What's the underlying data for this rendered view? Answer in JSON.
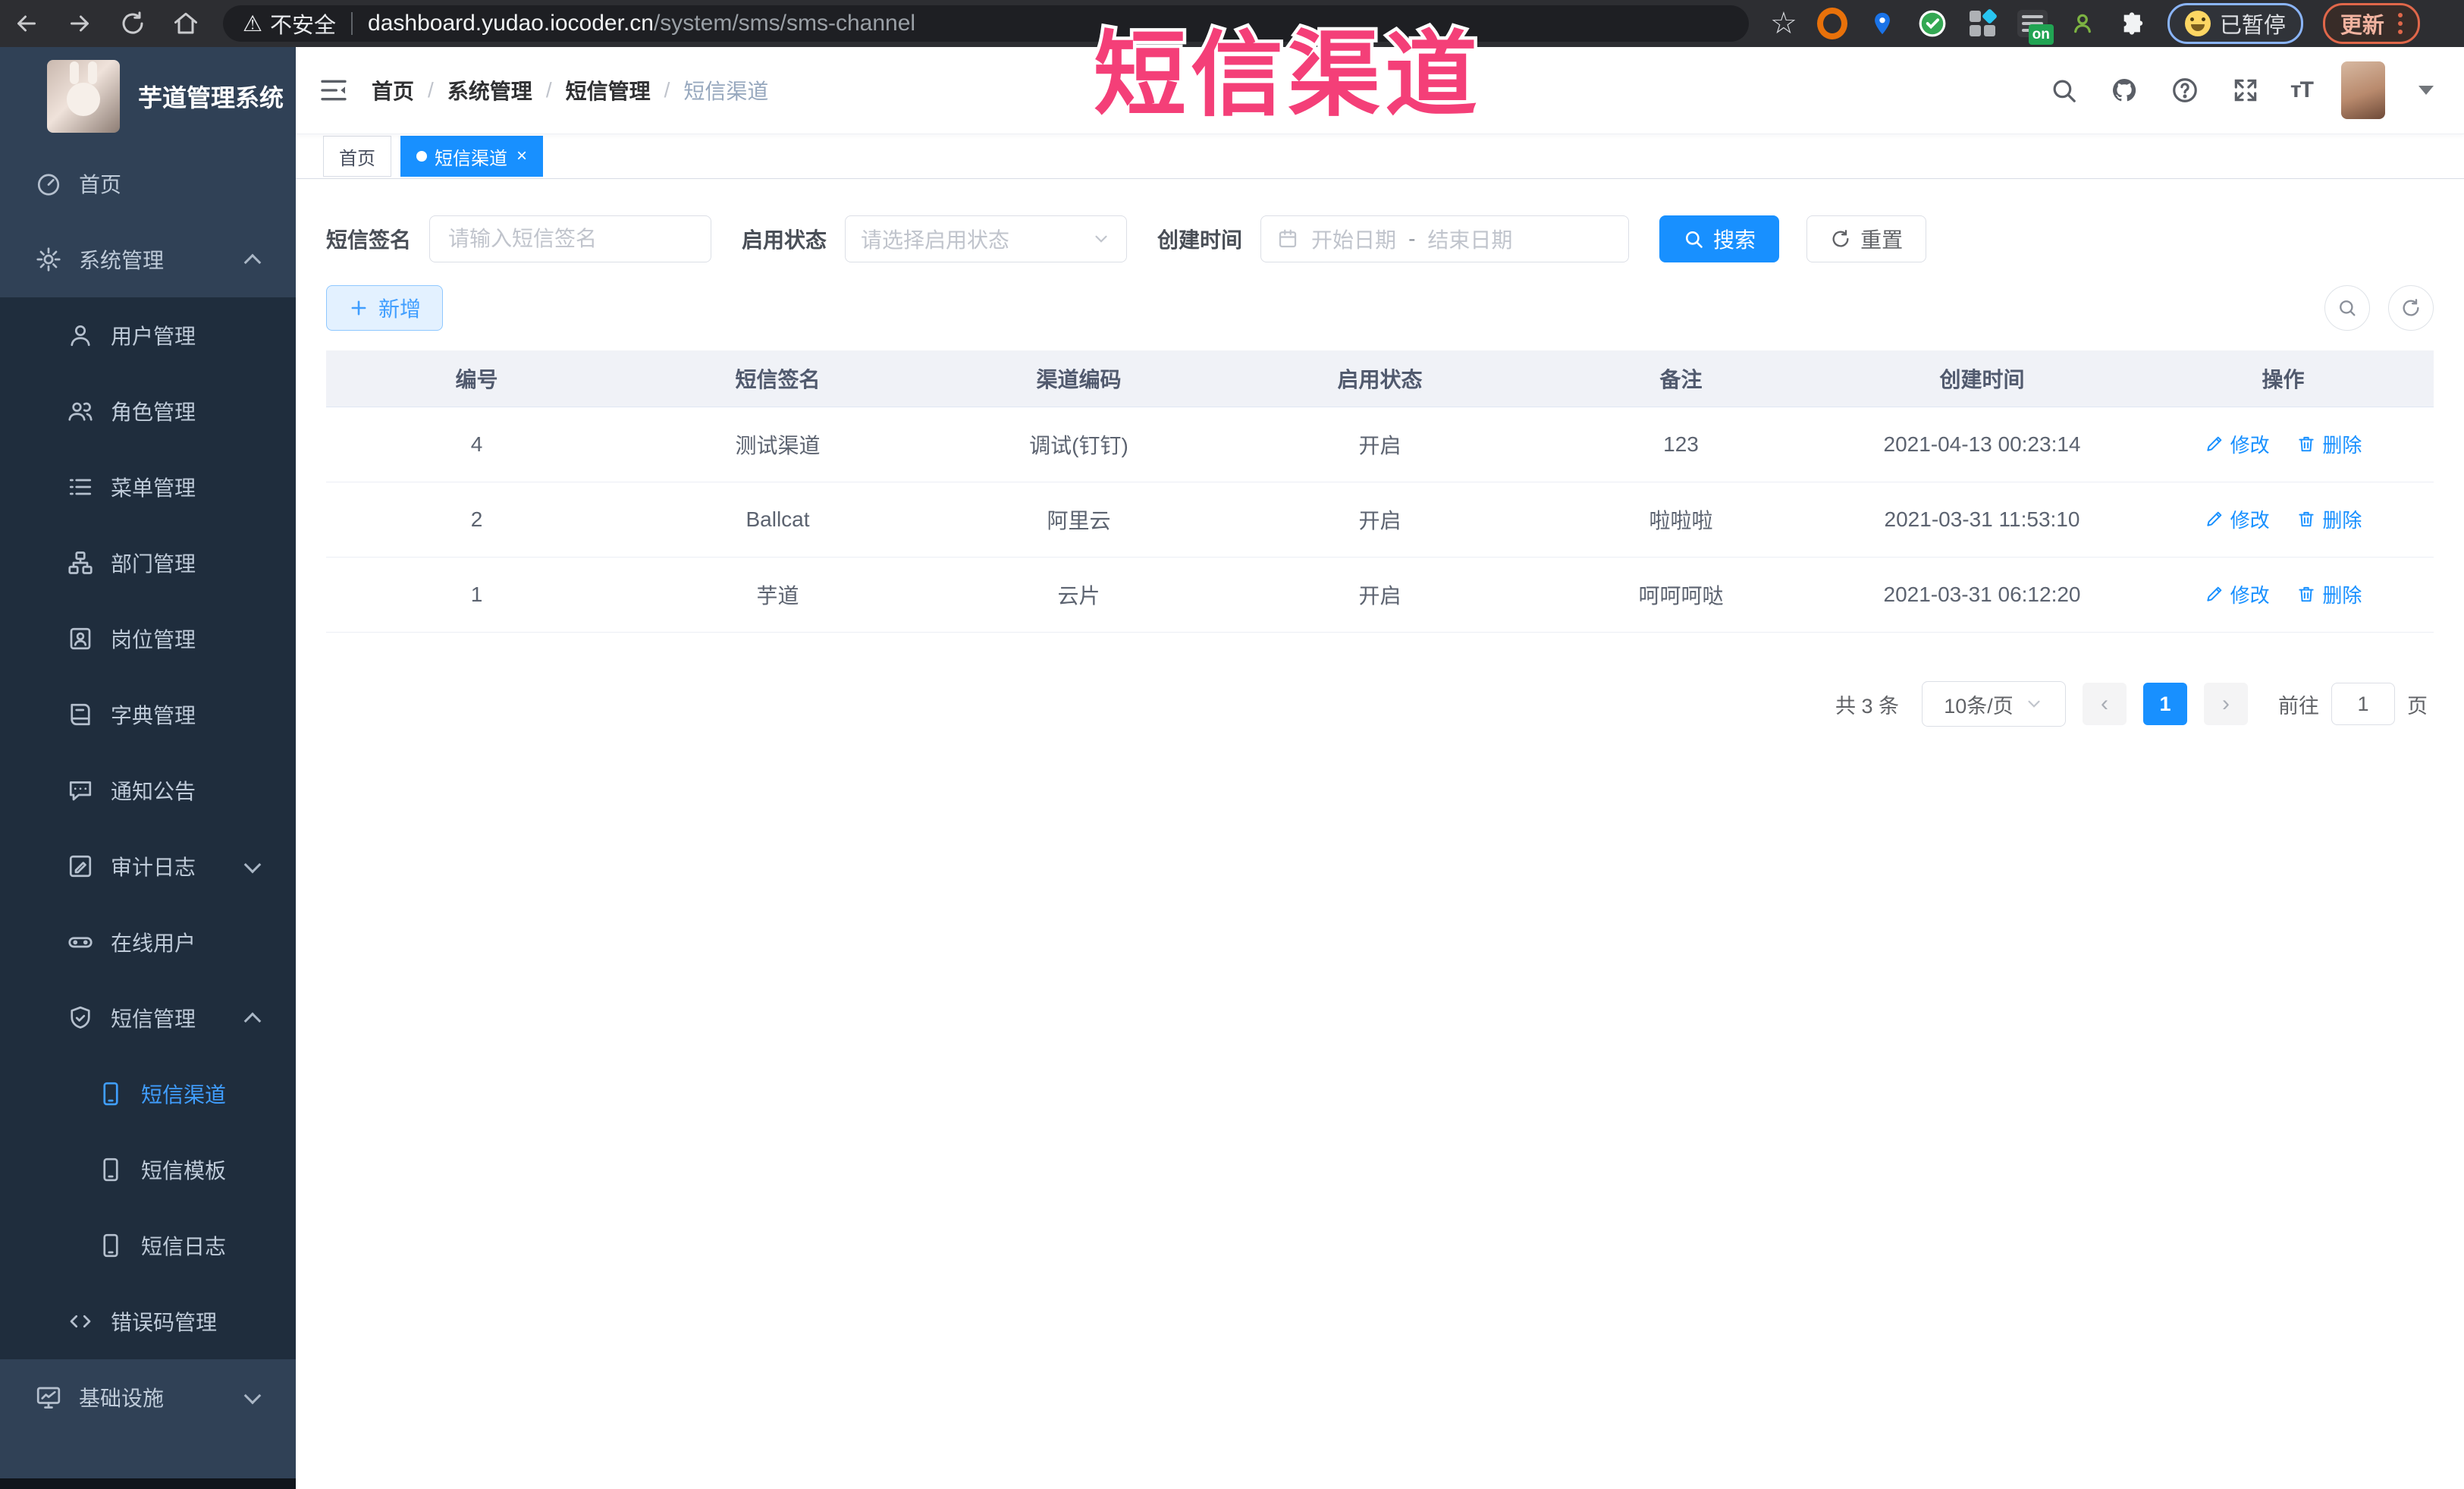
{
  "browser": {
    "security_label": "不安全",
    "url_host": "dashboard.yudao.iocoder.cn",
    "url_path": "/system/sms/sms-channel",
    "extension_badge": "on",
    "paused_label": "已暂停",
    "update_label": "更新"
  },
  "overlay": {
    "title": "短信渠道"
  },
  "sidebar": {
    "app_title": "芋道管理系统",
    "items": [
      {
        "label": "首页",
        "icon": "dashboard-icon",
        "level": 1
      },
      {
        "label": "系统管理",
        "icon": "gear-icon",
        "level": 1,
        "chevron": "up"
      },
      {
        "label": "用户管理",
        "icon": "user-icon",
        "level": 2
      },
      {
        "label": "角色管理",
        "icon": "users-icon",
        "level": 2
      },
      {
        "label": "菜单管理",
        "icon": "menu-list-icon",
        "level": 2
      },
      {
        "label": "部门管理",
        "icon": "org-tree-icon",
        "level": 2
      },
      {
        "label": "岗位管理",
        "icon": "id-badge-icon",
        "level": 2
      },
      {
        "label": "字典管理",
        "icon": "dictionary-icon",
        "level": 2
      },
      {
        "label": "通知公告",
        "icon": "comment-icon",
        "level": 2
      },
      {
        "label": "审计日志",
        "icon": "audit-log-icon",
        "level": 2,
        "chevron": "down"
      },
      {
        "label": "在线用户",
        "icon": "online-users-icon",
        "level": 2
      },
      {
        "label": "短信管理",
        "icon": "shield-check-icon",
        "level": 2,
        "chevron": "up"
      },
      {
        "label": "短信渠道",
        "icon": "mobile-icon",
        "level": 3,
        "active": true
      },
      {
        "label": "短信模板",
        "icon": "mobile-icon",
        "level": 3
      },
      {
        "label": "短信日志",
        "icon": "mobile-icon",
        "level": 3
      },
      {
        "label": "错误码管理",
        "icon": "code-icon",
        "level": 2
      },
      {
        "label": "基础设施",
        "icon": "monitor-icon",
        "level": 1,
        "chevron": "down"
      }
    ]
  },
  "breadcrumb": {
    "separator": "/",
    "items": [
      "首页",
      "系统管理",
      "短信管理",
      "短信渠道"
    ]
  },
  "tabs": [
    {
      "label": "首页",
      "active": false
    },
    {
      "label": "短信渠道",
      "active": true
    }
  ],
  "filters": {
    "signature_label": "短信签名",
    "signature_placeholder": "请输入短信签名",
    "status_label": "启用状态",
    "status_placeholder": "请选择启用状态",
    "created_label": "创建时间",
    "date_start_placeholder": "开始日期",
    "date_separator": "-",
    "date_end_placeholder": "结束日期",
    "search_label": "搜索",
    "reset_label": "重置"
  },
  "toolbar": {
    "add_label": "新增"
  },
  "table": {
    "columns": [
      "编号",
      "短信签名",
      "渠道编码",
      "启用状态",
      "备注",
      "创建时间",
      "操作"
    ],
    "edit_label": "修改",
    "delete_label": "删除",
    "rows": [
      {
        "id": "4",
        "signature": "测试渠道",
        "code": "调试(钉钉)",
        "status": "开启",
        "remark": "123",
        "created": "2021-04-13 00:23:14"
      },
      {
        "id": "2",
        "signature": "Ballcat",
        "code": "阿里云",
        "status": "开启",
        "remark": "啦啦啦",
        "created": "2021-03-31 11:53:10"
      },
      {
        "id": "1",
        "signature": "芋道",
        "code": "云片",
        "status": "开启",
        "remark": "呵呵呵哒",
        "created": "2021-03-31 06:12:20"
      }
    ]
  },
  "pagination": {
    "total_label": "共 3 条",
    "page_size_label": "10条/页",
    "current_page": "1",
    "goto_label": "前往",
    "goto_value": "1",
    "page_unit_label": "页"
  },
  "accent_colors": {
    "primary_blue": "#1890ff",
    "sidebar_bg": "#304156",
    "submenu_bg": "#1f2d3d",
    "overlay_pink": "#f43f78"
  }
}
